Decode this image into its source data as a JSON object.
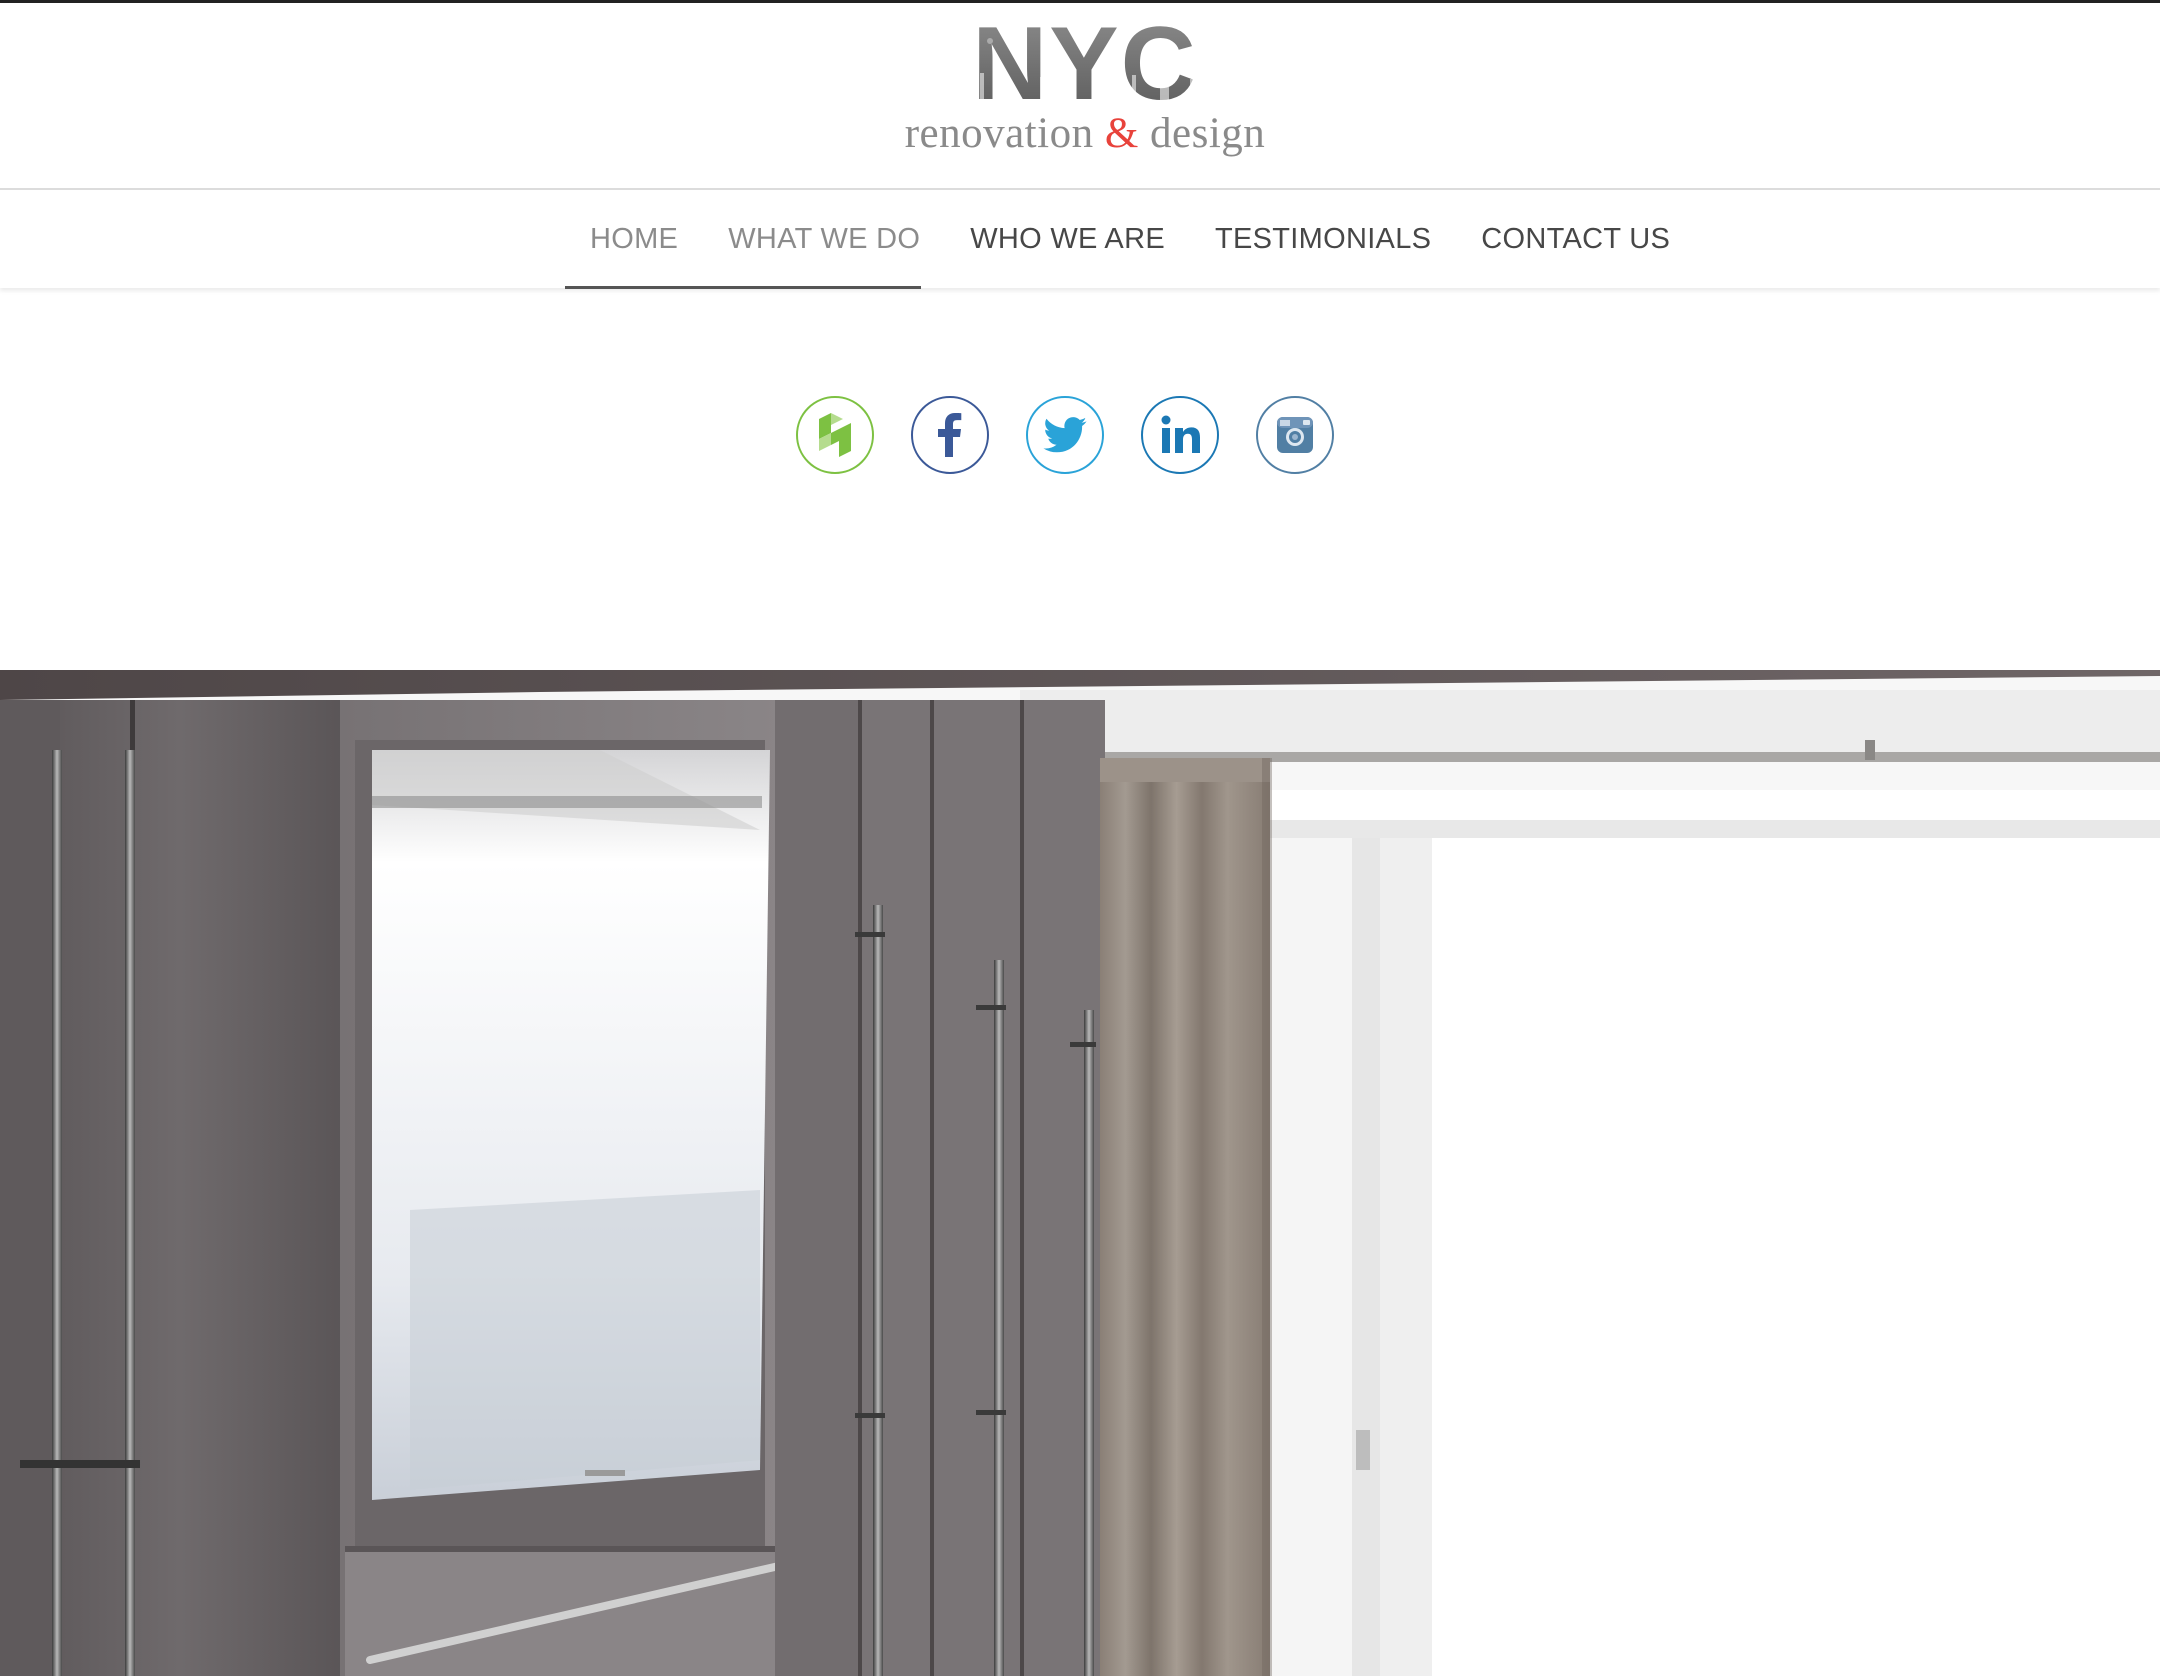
{
  "brand": {
    "name": "NYC",
    "tagline_part1": "renovation",
    "tagline_amp": "&",
    "tagline_part2": "design",
    "accent_color": "#e8423b"
  },
  "nav": {
    "items": [
      {
        "label": "HOME",
        "active": true
      },
      {
        "label": "WHAT WE DO",
        "active": false
      },
      {
        "label": "WHO WE ARE",
        "active": false
      },
      {
        "label": "TESTIMONIALS",
        "active": false
      },
      {
        "label": "CONTACT US",
        "active": false
      }
    ]
  },
  "social": {
    "items": [
      {
        "icon": "houzz-icon",
        "color": "#7dc142"
      },
      {
        "icon": "facebook-icon",
        "color": "#3b5998"
      },
      {
        "icon": "twitter-icon",
        "color": "#2aa3d8"
      },
      {
        "icon": "linkedin-icon",
        "color": "#1b78b4"
      },
      {
        "icon": "instagram-icon",
        "color": "#517fa4"
      }
    ]
  },
  "hero": {
    "image_subject": "bedroom-wardrobe-and-window"
  }
}
